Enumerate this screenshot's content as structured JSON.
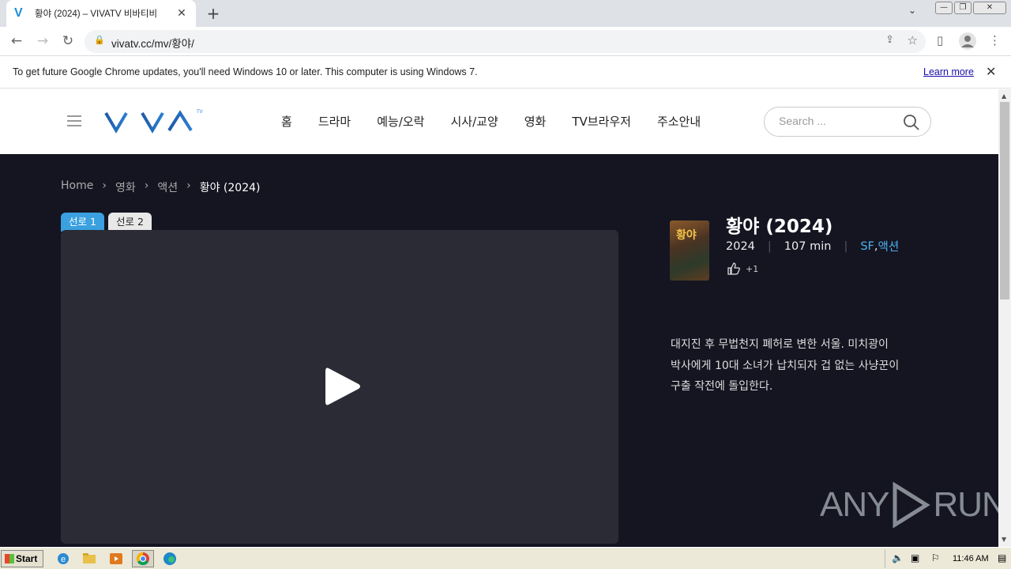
{
  "browser": {
    "tab_title": "황야 (2024) – VIVATV 비바티비",
    "tab_favicon": "V",
    "url": "vivatv.cc/mv/황야/",
    "infobar_message": "To get future Google Chrome updates, you'll need Windows 10 or later. This computer is using Windows 7.",
    "infobar_link": "Learn more"
  },
  "site": {
    "logo_text": "VIVA",
    "logo_sup": "TV",
    "nav": [
      "홈",
      "드라마",
      "예능/오락",
      "시사/교양",
      "영화",
      "TV브라우저",
      "주소안내"
    ],
    "search_placeholder": "Search ..."
  },
  "breadcrumb": [
    "Home",
    "영화",
    "액션",
    "황야 (2024)"
  ],
  "servers": [
    "선로 1",
    "선로 2"
  ],
  "movie": {
    "poster_text": "황야",
    "title": "황야 (2024)",
    "year": "2024",
    "runtime": "107 min",
    "genres": [
      "SF",
      "액션"
    ],
    "genre_comma": ",",
    "likes": "+1",
    "synopsis": "대지진 후 무법천지 폐허로 변한 서울. 미치광이 박사에게 10대 소녀가 납치되자 겁 없는 사냥꾼이 구출 작전에 돌입한다."
  },
  "watermark": {
    "left": "ANY",
    "right": "RUN"
  },
  "taskbar": {
    "start": "Start",
    "clock": "11:46 AM"
  },
  "colors": {
    "accent": "#3aa0e0",
    "genre": "#4fb0ee",
    "background": "#141521",
    "player": "#2a2b35"
  }
}
